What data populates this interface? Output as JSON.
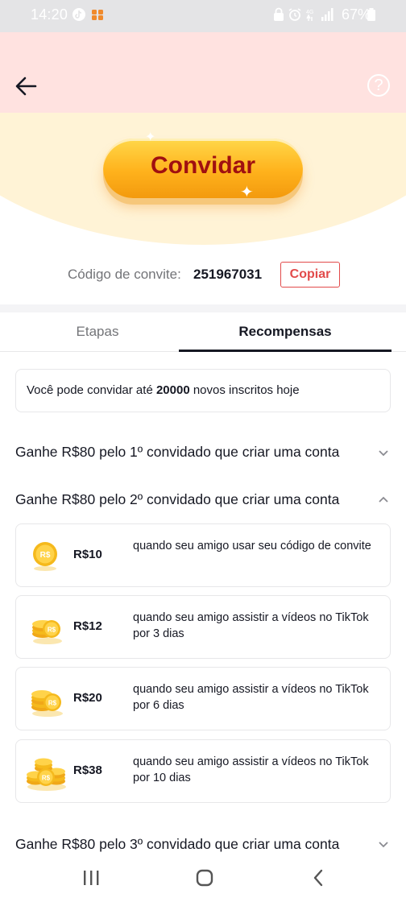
{
  "status_bar": {
    "time": "14:20",
    "battery": "67%",
    "icons": [
      "tiktok-notification-icon",
      "app-notification-icon",
      "lock-icon",
      "alarm-icon",
      "4g-signal-icon",
      "signal-bars-icon",
      "battery-icon"
    ]
  },
  "header": {
    "back_icon": "back-arrow-icon",
    "help_icon": "question-circle-icon",
    "background_color": "#ffe2e0"
  },
  "hero": {
    "invite_button": "Convidar"
  },
  "invite_code": {
    "label": "Código de convite:",
    "value": "251967031",
    "copy_button": "Copiar"
  },
  "tabs": [
    {
      "label": "Etapas",
      "selected": false
    },
    {
      "label": "Recompensas",
      "selected": true
    }
  ],
  "info_box": {
    "prefix": "Você pode convidar até ",
    "limit": "20000",
    "suffix": " novos inscritos hoje"
  },
  "sections": [
    {
      "title": "Ganhe R$80 pelo 1º convidado que criar uma conta",
      "expanded": false
    },
    {
      "title": "Ganhe R$80 pelo 2º convidado que criar uma conta",
      "expanded": true
    },
    {
      "title": "Ganhe R$80 pelo 3º convidado que criar uma conta",
      "expanded": false
    }
  ],
  "rewards": [
    {
      "amount": "R$10",
      "description": "quando seu amigo usar seu código de convite",
      "icon": "single-coin-icon"
    },
    {
      "amount": "R$12",
      "description": "quando seu amigo assistir a vídeos no TikTok por 3 dias",
      "icon": "coin-stack-small-icon"
    },
    {
      "amount": "R$20",
      "description": "quando seu amigo assistir a vídeos no TikTok por 6 dias",
      "icon": "coin-stack-medium-icon"
    },
    {
      "amount": "R$38",
      "description": "quando seu amigo assistir a vídeos no TikTok por 10 dias",
      "icon": "coin-pile-large-icon"
    }
  ],
  "coin_label": "R$",
  "nav": [
    "recent-apps-icon",
    "home-icon",
    "back-icon"
  ],
  "colors": {
    "accent_red": "#e24b4b",
    "button_yellow": "#ffb21c",
    "button_text": "#a01010"
  }
}
